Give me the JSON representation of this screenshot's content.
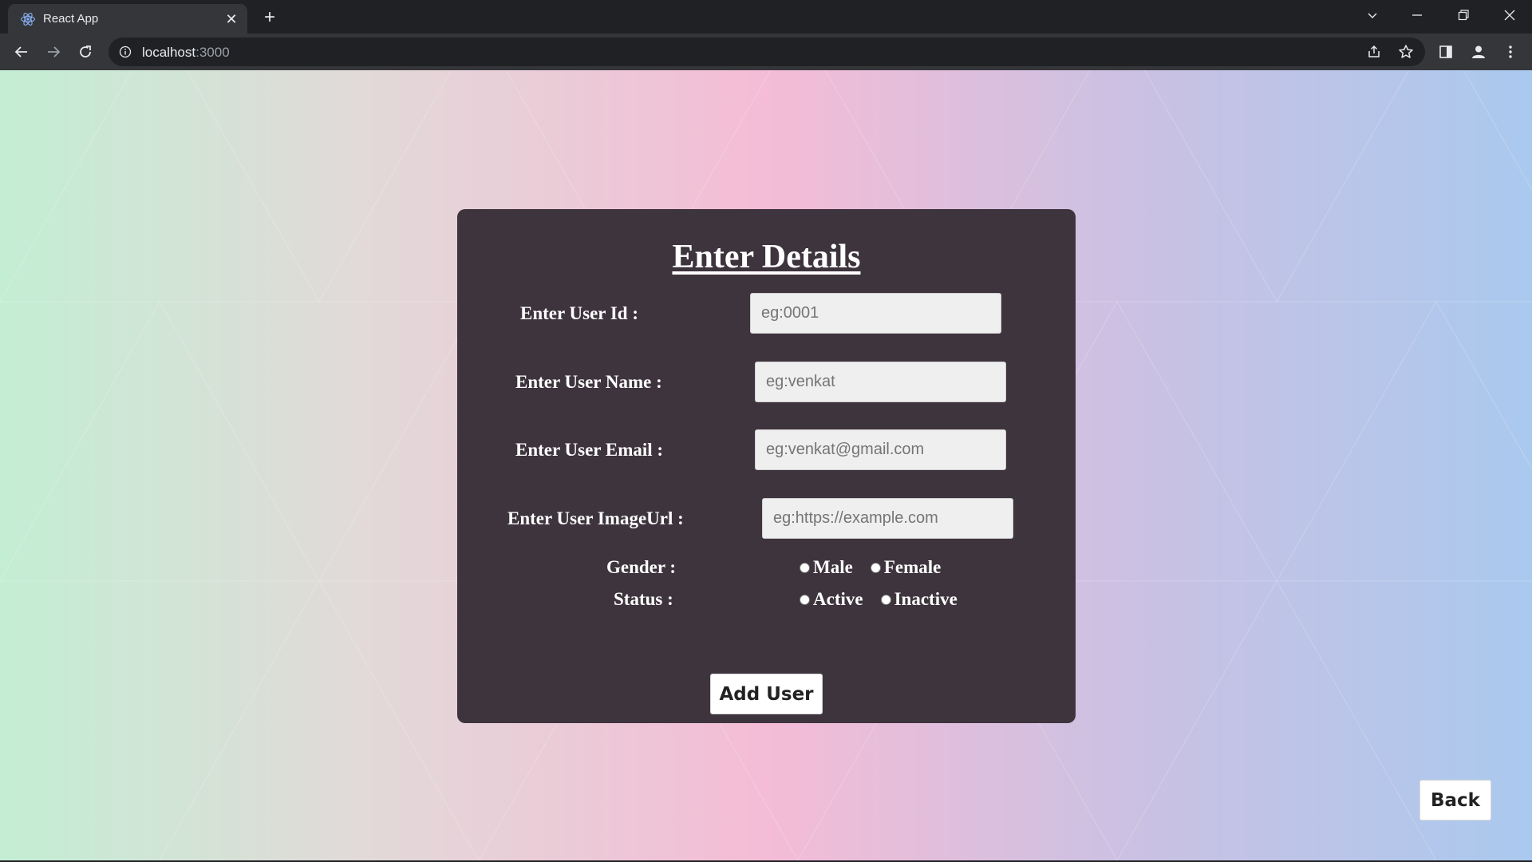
{
  "browser": {
    "tab_title": "React App",
    "tab_close_glyph": "✕",
    "new_tab_glyph": "+",
    "url_host": "localhost",
    "url_port": ":3000",
    "icons": [
      "react-favicon",
      "close-icon",
      "plus-icon",
      "chevron-down-icon",
      "minimize-icon",
      "restore-icon",
      "window-close-icon",
      "back-arrow-icon",
      "forward-arrow-icon",
      "reload-icon",
      "info-icon",
      "share-icon",
      "star-icon",
      "side-panel-icon",
      "profile-icon",
      "kebab-menu-icon"
    ]
  },
  "form": {
    "title": "Enter Details",
    "fields": [
      {
        "label": "Enter User Id :",
        "placeholder": "eg:0001"
      },
      {
        "label": "Enter User Name :",
        "placeholder": "eg:venkat"
      },
      {
        "label": "Enter User Email :",
        "placeholder": "eg:venkat@gmail.com"
      },
      {
        "label": "Enter User ImageUrl :",
        "placeholder": "eg:https://example.com"
      }
    ],
    "gender": {
      "label": "Gender :",
      "options": [
        "Male",
        "Female"
      ]
    },
    "status": {
      "label": "Status :",
      "options": [
        "Active",
        "Inactive"
      ]
    },
    "submit_label": "Add User"
  },
  "back_label": "Back",
  "colors": {
    "card_bg": "#3e343d",
    "chrome_dark": "#202124",
    "chrome_toolbar": "#35363a",
    "gradient": [
      "#c3eed4",
      "#e2d9d8",
      "#f4bcd6",
      "#c9c1e3",
      "#aac9ee"
    ]
  }
}
